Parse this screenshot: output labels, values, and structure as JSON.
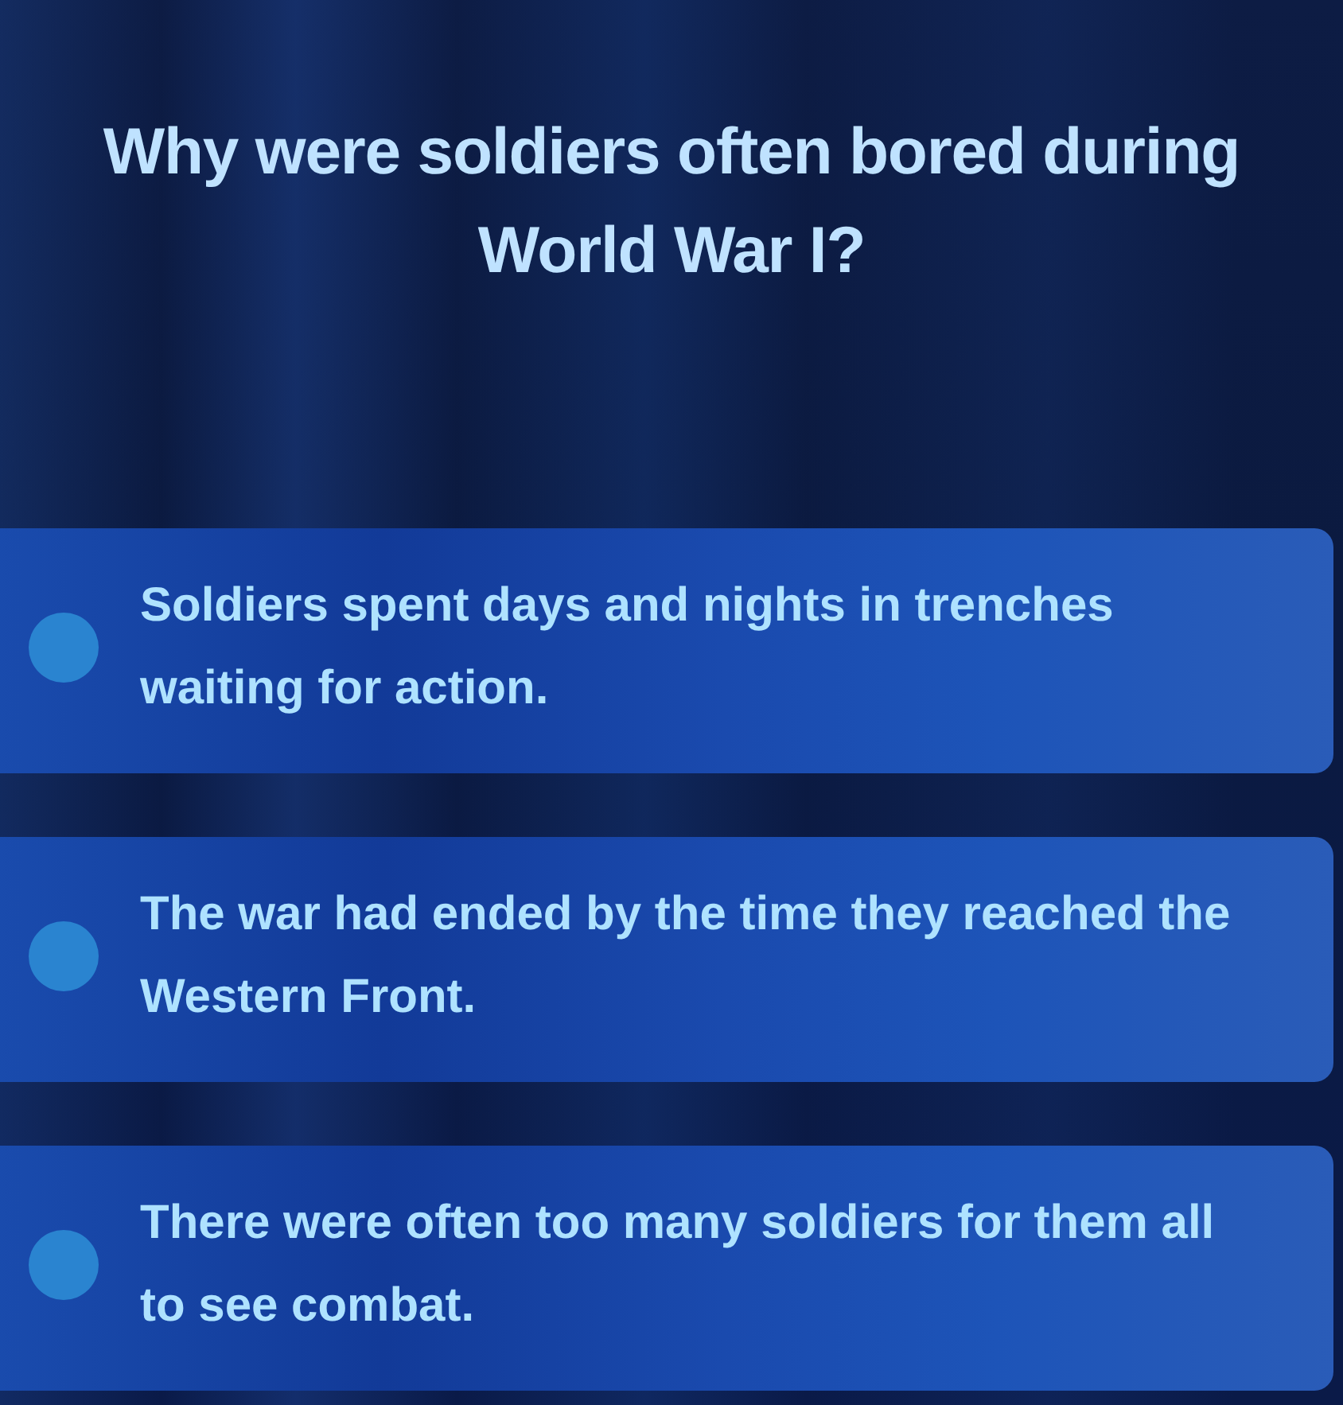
{
  "question": "Why were soldiers often bored during World War I?",
  "options": [
    {
      "text": "Soldiers spent days and nights in trenches waiting for action.",
      "selected": false
    },
    {
      "text": "The war had ended by the time they reached the Western Front.",
      "selected": false
    },
    {
      "text": "There were often too many soldiers for them all to see combat.",
      "selected": false
    }
  ]
}
